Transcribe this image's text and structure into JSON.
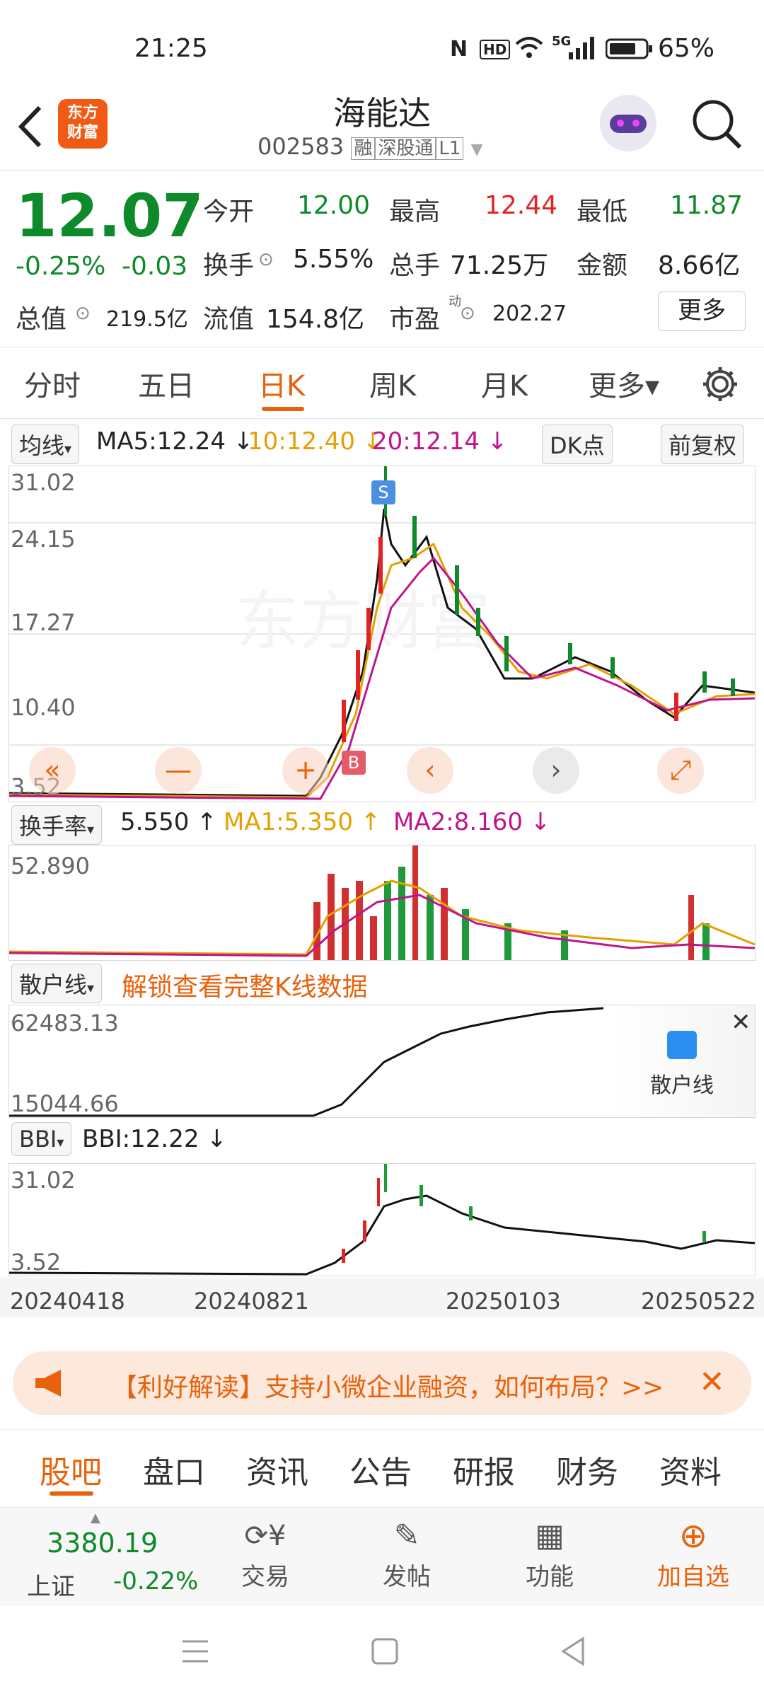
{
  "status_bar": {
    "time": "21:25",
    "battery": "65%",
    "network": "5G",
    "icons": [
      "nfc-icon",
      "hd-icon",
      "wifi-icon",
      "signal-icon",
      "battery-icon"
    ]
  },
  "header": {
    "back_icon": "chevron-left-icon",
    "logo_text": "东方\n财富",
    "stock_name": "海能达",
    "stock_code": "002583",
    "badges": [
      "融",
      "深股通",
      "L1"
    ],
    "robot_icon": "robot-avatar-icon",
    "search_icon": "search-icon"
  },
  "quote": {
    "price": "12.07",
    "change_pct": "-0.25%",
    "change": "-0.03",
    "open_label": "今开",
    "open": "12.00",
    "high_label": "最高",
    "high": "12.44",
    "low_label": "最低",
    "low": "11.87",
    "turnover_label": "换手",
    "turnover": "5.55%",
    "volume_label": "总手",
    "volume": "71.25万",
    "amount_label": "金额",
    "amount": "8.66亿",
    "mktcap_label": "总值",
    "mktcap": "219.5亿",
    "float_label": "流值",
    "float": "154.8亿",
    "pe_label": "市盈",
    "pe_sup": "动",
    "pe": "202.27",
    "more_button": "更多"
  },
  "k_tabs": [
    {
      "label": "分时",
      "active": false
    },
    {
      "label": "五日",
      "active": false
    },
    {
      "label": "日K",
      "active": true
    },
    {
      "label": "周K",
      "active": false
    },
    {
      "label": "月K",
      "active": false
    },
    {
      "label": "更多▾",
      "active": false
    }
  ],
  "settings_icon": "gear-icon",
  "ma_bar": {
    "selector": "均线",
    "ma5": "MA5:12.24 ↓",
    "ma10": "10:12.40 ↓",
    "ma20": "20:12.14 ↓",
    "dk_button": "DK点",
    "adjust_button": "前复权"
  },
  "main_chart": {
    "y_labels": [
      "31.02",
      "24.15",
      "17.27",
      "10.40",
      "3.52"
    ],
    "watermark": "东方财富",
    "sell_marker": "S",
    "buy_marker": "B",
    "controls": [
      "«",
      "—",
      "+",
      "‹",
      "›",
      "⤢"
    ]
  },
  "turnover_panel": {
    "selector": "换手率",
    "value": "5.550 ↑",
    "ma1": "MA1:5.350 ↑",
    "ma2": "MA2:8.160 ↓",
    "y_top": "52.890"
  },
  "retail_panel": {
    "selector": "散户线",
    "unlock_text": "解锁查看完整K线数据",
    "y_top": "62483.13",
    "y_bottom": "15044.66",
    "overlay_label": "散户线",
    "close_icon": "close-icon"
  },
  "bbi_panel": {
    "selector": "BBI",
    "value": "BBI:12.22 ↓",
    "y_top": "31.02",
    "y_bottom": "3.52",
    "dates": [
      "20240418",
      "20240821",
      "20250103",
      "20250522"
    ]
  },
  "news_banner": {
    "icon": "megaphone-icon",
    "text": "【利好解读】支持小微企业融资，如何布局？>>",
    "close_icon": "close-icon"
  },
  "bottom_tabs": [
    "股吧",
    "盘口",
    "资讯",
    "公告",
    "研报",
    "财务",
    "资料"
  ],
  "bottom_nav": {
    "index_value": "3380.19",
    "index_name": "上证",
    "index_change": "-0.22%",
    "items": [
      {
        "label": "交易",
        "icon": "yen-exchange-icon"
      },
      {
        "label": "发帖",
        "icon": "edit-icon"
      },
      {
        "label": "功能",
        "icon": "grid-icon"
      },
      {
        "label": "加自选",
        "icon": "add-circle-icon"
      }
    ]
  },
  "colors": {
    "up": "#e02424",
    "down": "#0f8a2b",
    "accent": "#e8620c",
    "ma10": "#e4a000",
    "ma20": "#c0148c"
  },
  "system_nav": [
    "menu-icon",
    "home-icon",
    "back-triangle-icon"
  ]
}
